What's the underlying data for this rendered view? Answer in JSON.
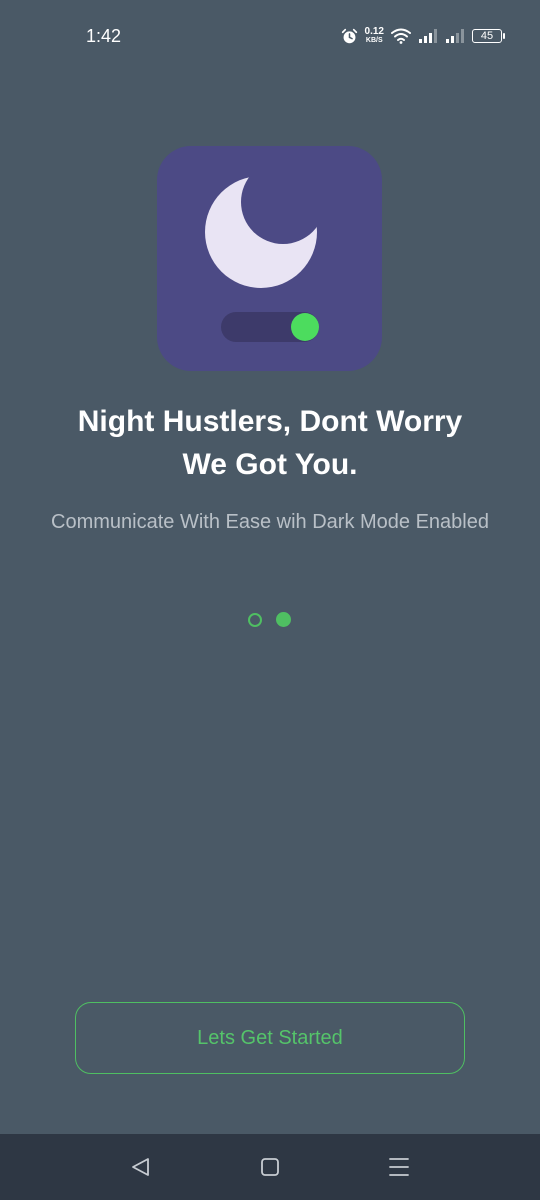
{
  "status_bar": {
    "time": "1:42",
    "net_speed_value": "0.12",
    "net_speed_unit": "KB/S",
    "battery": "45",
    "icons": [
      "alarm-icon",
      "wifi-icon",
      "signal-icon",
      "signal-icon",
      "battery-icon"
    ]
  },
  "hero": {
    "icons": [
      "moon-icon",
      "toggle-icon"
    ],
    "colors": {
      "card": "#4c4a85",
      "moon": "#e9e4f4",
      "toggle_track": "#3d3a6a",
      "toggle_knob": "#4cdc5e"
    }
  },
  "onboarding": {
    "headline_line1": "Night Hustlers, Dont Worry",
    "headline_line2": "We Got You.",
    "subtitle": "Communicate With Ease wih Dark Mode Enabled",
    "page_index": 2,
    "page_count": 2
  },
  "actions": {
    "start_label": "Lets Get Started"
  },
  "nav": {
    "icons": [
      "back-icon",
      "home-icon",
      "recents-icon"
    ]
  },
  "colors": {
    "background": "#4a5966",
    "accent": "#4fbf62",
    "nav_background": "#2e3744"
  }
}
